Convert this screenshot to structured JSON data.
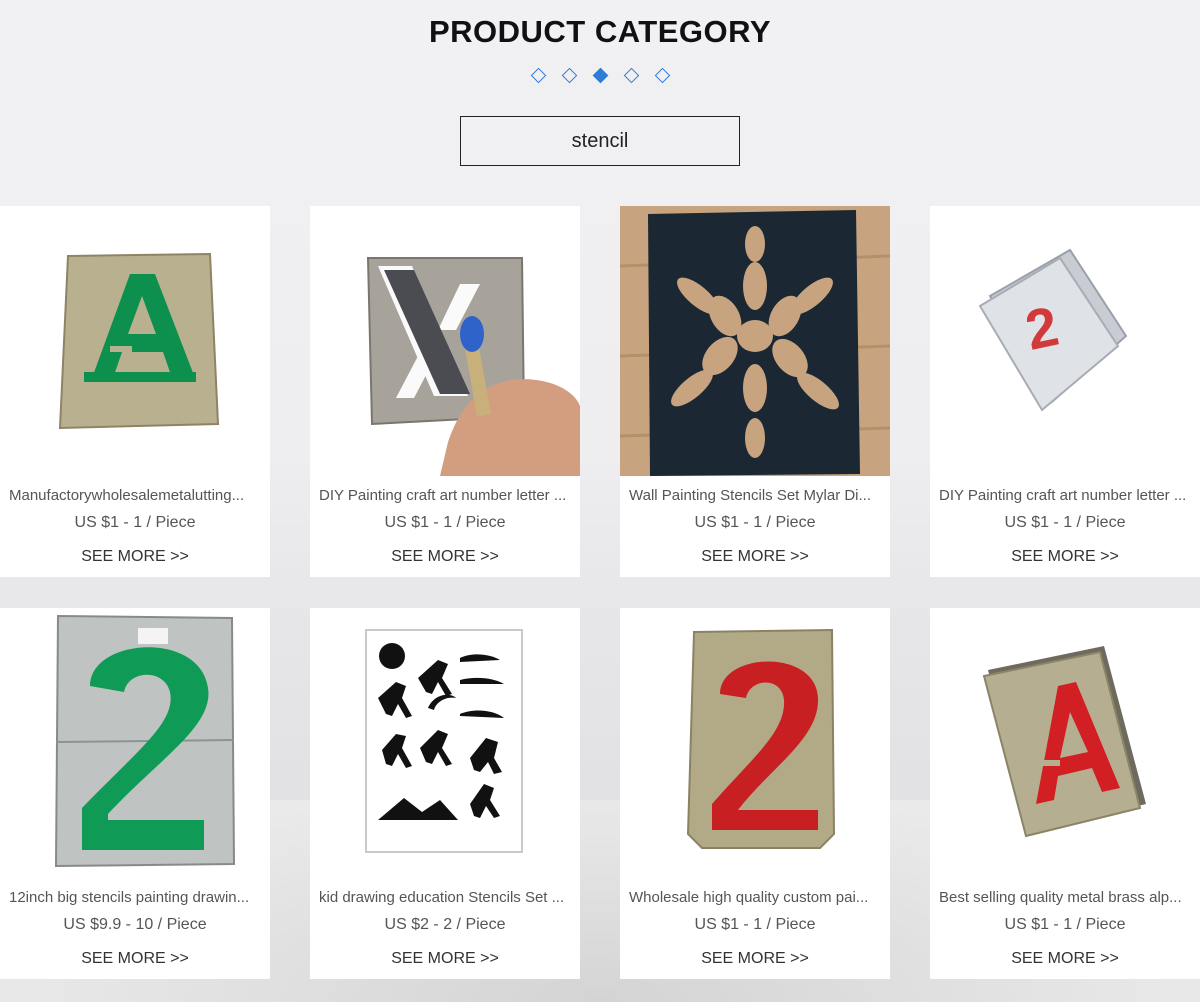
{
  "header": {
    "title": "PRODUCT CATEGORY",
    "category_tag": "stencil",
    "pager_dots": 5,
    "active_dot": 3
  },
  "colors": {
    "accent": "#2f7bd6",
    "card_bg": "#ffffff"
  },
  "products": [
    {
      "name": "Manufactorywholesalemetalutting...",
      "price": "US $1 - 1 / Piece",
      "more": "SEE MORE >>",
      "image": "brass-stencil-letter-A-green"
    },
    {
      "name": "DIY Painting craft art number letter ...",
      "price": "US $1 - 1 / Piece",
      "more": "SEE MORE >>",
      "image": "stencil-letter-X-with-brush"
    },
    {
      "name": "Wall Painting Stencils Set Mylar Di...",
      "price": "US $1 - 1 / Piece",
      "more": "SEE MORE >>",
      "image": "flower-mylar-stencil-dark"
    },
    {
      "name": "DIY Painting craft art number letter ...",
      "price": "US $1 - 1 / Piece",
      "more": "SEE MORE >>",
      "image": "stencil-stack-number-2-red"
    },
    {
      "name": "12inch big stencils painting drawin...",
      "price": "US $9.9 - 10 / Piece",
      "more": "SEE MORE >>",
      "image": "large-stencil-number-2-green"
    },
    {
      "name": "kid drawing education Stencils Set ...",
      "price": "US $2 - 2 / Piece",
      "more": "SEE MORE >>",
      "image": "deer-animal-stencil-sheet"
    },
    {
      "name": "Wholesale high quality custom pai...",
      "price": "US $1 - 1 / Piece",
      "more": "SEE MORE >>",
      "image": "brass-stencil-number-2-red"
    },
    {
      "name": "Best selling quality metal brass alp...",
      "price": "US $1 - 1 / Piece",
      "more": "SEE MORE >>",
      "image": "brass-stencil-stack-letter-A-red"
    }
  ]
}
